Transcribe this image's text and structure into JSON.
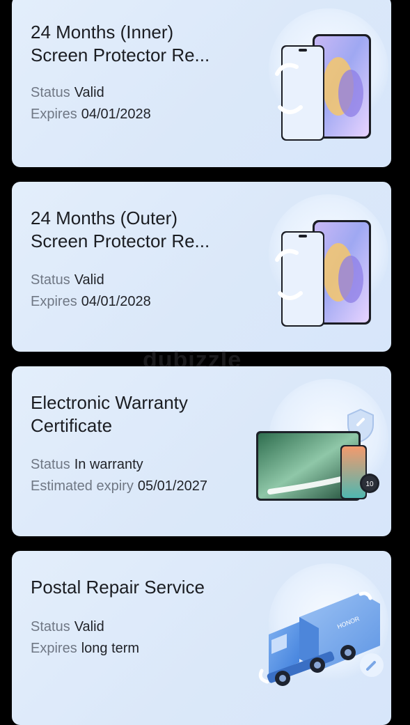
{
  "cards": [
    {
      "title": "24 Months (Inner)\nScreen Protector Re...",
      "status_key": "Status",
      "status_value": "Valid",
      "expiry_key": "Expires",
      "expiry_value": "04/01/2028",
      "illustration_icon": "phone-screen-replace-icon"
    },
    {
      "title": "24 Months (Outer)\nScreen Protector Re...",
      "status_key": "Status",
      "status_value": "Valid",
      "expiry_key": "Expires",
      "expiry_value": "04/01/2028",
      "illustration_icon": "phone-screen-replace-icon"
    },
    {
      "title": "Electronic Warranty\nCertificate",
      "status_key": "Status",
      "status_value": "In warranty",
      "expiry_key": "Estimated expiry",
      "expiry_value": "05/01/2027",
      "illustration_icon": "devices-shield-icon"
    },
    {
      "title": "Postal Repair Service",
      "status_key": "Status",
      "status_value": "Valid",
      "expiry_key": "Expires",
      "expiry_value": "long term",
      "illustration_icon": "delivery-truck-icon",
      "truck_brand": "HONOR"
    }
  ],
  "watermark": "dubizzle",
  "watch_time": "10"
}
